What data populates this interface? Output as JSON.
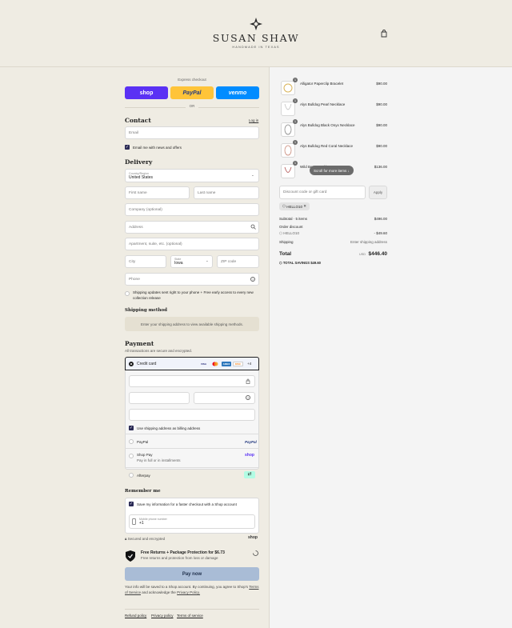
{
  "brand": {
    "name": "SUSAN SHAW",
    "tagline": "HANDMADE IN TEXAS"
  },
  "express": {
    "label": "Express checkout",
    "shop": "shop",
    "paypal": "PayPal",
    "venmo": "venmo",
    "or": "OR"
  },
  "contact": {
    "title": "Contact",
    "login": "Log in",
    "email_placeholder": "Email",
    "news_label": "Email me with news and offers"
  },
  "delivery": {
    "title": "Delivery",
    "country_label": "Country/Region",
    "country_value": "United States",
    "first_name": "First name",
    "last_name": "Last name",
    "company": "Company (optional)",
    "address": "Address",
    "apartment": "Apartment, suite, etc. (optional)",
    "city": "City",
    "state_label": "State",
    "state_value": "Iowa",
    "zip": "ZIP code",
    "phone": "Phone",
    "sms_label": "Shipping updates sent right to your phone + Free early access to every new collection release"
  },
  "shipping_method": {
    "title": "Shipping method",
    "notice": "Enter your shipping address to view available shipping methods."
  },
  "payment": {
    "title": "Payment",
    "subtitle": "All transactions are secure and encrypted.",
    "credit_card": "Credit card",
    "more_cards": "+4",
    "billing_label": "Use shipping address as billing address",
    "paypal": "PayPal",
    "shop_pay": "Shop Pay",
    "shop_pay_sub": "Pay in full or in installments",
    "afterpay": "Afterpay",
    "paypal_logo": "PayPal",
    "shop_logo": "shop"
  },
  "remember": {
    "title": "Remember me",
    "save_label": "Save my information for a faster checkout with a Shop account",
    "mobile_label": "Mobile phone number",
    "mobile_value": "+1",
    "secure": "Secured and encrypted",
    "shop": "shop"
  },
  "protection": {
    "title": "Free Returns + Package Protection for $6.73",
    "sub": "Free returns and protection from loss or damage"
  },
  "pay_now": "Pay now",
  "legal": {
    "text1": "Your info will be saved to a Shop account. By continuing, you agree to Shop's",
    "tos": "Terms of Service",
    "and": "and acknowledge the",
    "privacy": "Privacy Policy."
  },
  "footer": {
    "refund": "Refund policy",
    "privacy": "Privacy policy",
    "terms": "Terms of service"
  },
  "cart": {
    "items": [
      {
        "name": "Alligator Paperclip Bracelet",
        "price": "$90.00",
        "qty": "1"
      },
      {
        "name": "Alys Bulldog Pearl Necklace",
        "price": "$90.00",
        "qty": "1"
      },
      {
        "name": "Alys Bulldog Black Onyx Necklace",
        "price": "$90.00",
        "qty": "1"
      },
      {
        "name": "Alys Bulldog Red Coral Necklace",
        "price": "$90.00",
        "qty": "1"
      },
      {
        "name": "Wild Berry Necklace",
        "price": "$136.00",
        "qty": "1"
      }
    ],
    "scroll_hint": "Scroll for more items",
    "discount_placeholder": "Discount code or gift card",
    "apply": "Apply",
    "code": "HELLO10",
    "subtotal_label": "Subtotal · 5 items",
    "subtotal": "$496.00",
    "order_discount": "Order discount",
    "discount_code": "HELLO10",
    "discount_amount": "- $49.60",
    "shipping_label": "Shipping",
    "shipping_value": "Enter shipping address",
    "total_label": "Total",
    "currency": "USD",
    "total": "$446.40",
    "savings_label": "TOTAL SAVINGS",
    "savings": "$49.60"
  },
  "colors": {
    "shop": "#5a31f4",
    "paypal": "#ffc439",
    "venmo": "#008cff",
    "pay_button": "#a9bcd6",
    "checkbox": "#2a2a55"
  }
}
